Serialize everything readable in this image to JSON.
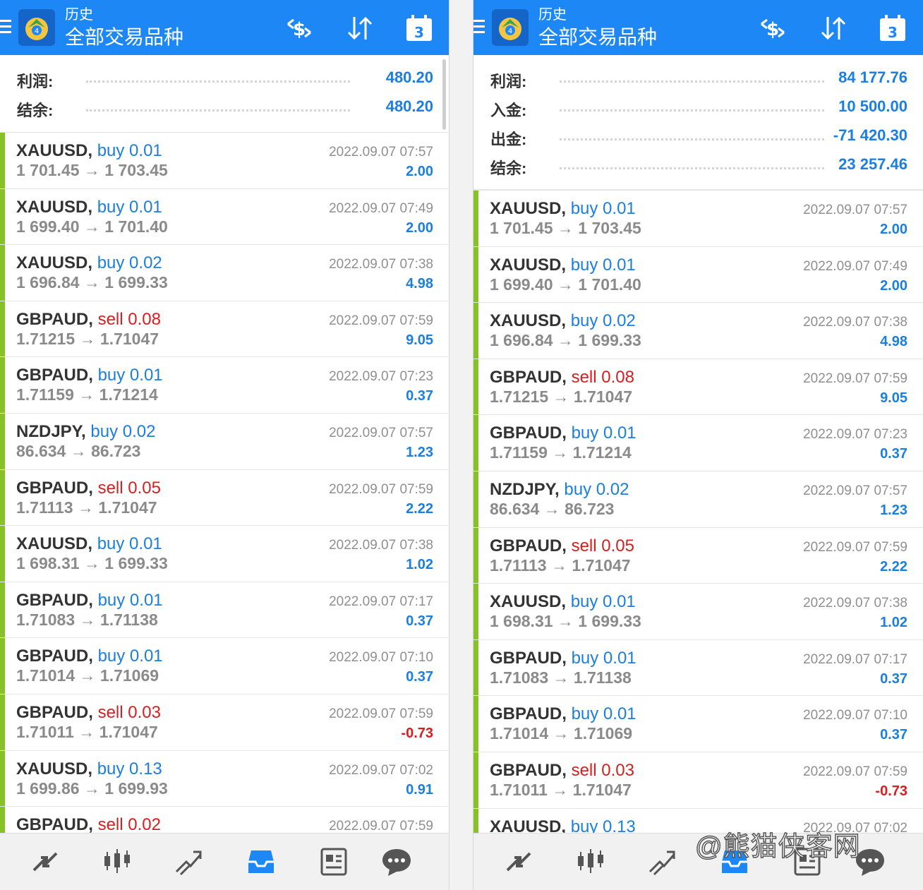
{
  "colors": {
    "header": "#1d88f5",
    "accent": "#1a7fe0",
    "sell": "#d81e1e",
    "profit_bar": "#86c225"
  },
  "left": {
    "header": {
      "subtitle": "历史",
      "title": "全部交易品种",
      "calendar_day": "3"
    },
    "summary": [
      {
        "label": "利润:",
        "value": "480.20"
      },
      {
        "label": "结余:",
        "value": "480.20"
      }
    ],
    "deals": [
      {
        "symbol": "XAUUSD,",
        "type": "buy 0.01",
        "side": "buy",
        "prices": "1 701.45 → 1 703.45",
        "time": "2022.09.07 07:57",
        "profit": "2.00"
      },
      {
        "symbol": "XAUUSD,",
        "type": "buy 0.01",
        "side": "buy",
        "prices": "1 699.40 → 1 701.40",
        "time": "2022.09.07 07:49",
        "profit": "2.00"
      },
      {
        "symbol": "XAUUSD,",
        "type": "buy 0.02",
        "side": "buy",
        "prices": "1 696.84 → 1 699.33",
        "time": "2022.09.07 07:38",
        "profit": "4.98"
      },
      {
        "symbol": "GBPAUD,",
        "type": "sell 0.08",
        "side": "sell",
        "prices": "1.71215 → 1.71047",
        "time": "2022.09.07 07:59",
        "profit": "9.05"
      },
      {
        "symbol": "GBPAUD,",
        "type": "buy 0.01",
        "side": "buy",
        "prices": "1.71159 → 1.71214",
        "time": "2022.09.07 07:23",
        "profit": "0.37"
      },
      {
        "symbol": "NZDJPY,",
        "type": "buy 0.02",
        "side": "buy",
        "prices": "86.634 → 86.723",
        "time": "2022.09.07 07:57",
        "profit": "1.23"
      },
      {
        "symbol": "GBPAUD,",
        "type": "sell 0.05",
        "side": "sell",
        "prices": "1.71113 → 1.71047",
        "time": "2022.09.07 07:59",
        "profit": "2.22"
      },
      {
        "symbol": "XAUUSD,",
        "type": "buy 0.01",
        "side": "buy",
        "prices": "1 698.31 → 1 699.33",
        "time": "2022.09.07 07:38",
        "profit": "1.02"
      },
      {
        "symbol": "GBPAUD,",
        "type": "buy 0.01",
        "side": "buy",
        "prices": "1.71083 → 1.71138",
        "time": "2022.09.07 07:17",
        "profit": "0.37"
      },
      {
        "symbol": "GBPAUD,",
        "type": "buy 0.01",
        "side": "buy",
        "prices": "1.71014 → 1.71069",
        "time": "2022.09.07 07:10",
        "profit": "0.37"
      },
      {
        "symbol": "GBPAUD,",
        "type": "sell 0.03",
        "side": "sell",
        "prices": "1.71011 → 1.71047",
        "time": "2022.09.07 07:59",
        "profit": "-0.73"
      },
      {
        "symbol": "XAUUSD,",
        "type": "buy 0.13",
        "side": "buy",
        "prices": "1 699.86 → 1 699.93",
        "time": "2022.09.07 07:02",
        "profit": "0.91"
      },
      {
        "symbol": "GBPAUD,",
        "type": "sell 0.02",
        "side": "sell",
        "prices": "",
        "time": "2022.09.07 07:59",
        "profit": ""
      }
    ]
  },
  "right": {
    "header": {
      "subtitle": "历史",
      "title": "全部交易品种",
      "calendar_day": "3"
    },
    "summary": [
      {
        "label": "利润:",
        "value": "84 177.76"
      },
      {
        "label": "入金:",
        "value": "10 500.00"
      },
      {
        "label": "出金:",
        "value": "-71 420.30"
      },
      {
        "label": "结余:",
        "value": "23 257.46"
      }
    ],
    "deals": [
      {
        "symbol": "XAUUSD,",
        "type": "buy 0.01",
        "side": "buy",
        "prices": "1 701.45 → 1 703.45",
        "time": "2022.09.07 07:57",
        "profit": "2.00"
      },
      {
        "symbol": "XAUUSD,",
        "type": "buy 0.01",
        "side": "buy",
        "prices": "1 699.40 → 1 701.40",
        "time": "2022.09.07 07:49",
        "profit": "2.00"
      },
      {
        "symbol": "XAUUSD,",
        "type": "buy 0.02",
        "side": "buy",
        "prices": "1 696.84 → 1 699.33",
        "time": "2022.09.07 07:38",
        "profit": "4.98"
      },
      {
        "symbol": "GBPAUD,",
        "type": "sell 0.08",
        "side": "sell",
        "prices": "1.71215 → 1.71047",
        "time": "2022.09.07 07:59",
        "profit": "9.05"
      },
      {
        "symbol": "GBPAUD,",
        "type": "buy 0.01",
        "side": "buy",
        "prices": "1.71159 → 1.71214",
        "time": "2022.09.07 07:23",
        "profit": "0.37"
      },
      {
        "symbol": "NZDJPY,",
        "type": "buy 0.02",
        "side": "buy",
        "prices": "86.634 → 86.723",
        "time": "2022.09.07 07:57",
        "profit": "1.23"
      },
      {
        "symbol": "GBPAUD,",
        "type": "sell 0.05",
        "side": "sell",
        "prices": "1.71113 → 1.71047",
        "time": "2022.09.07 07:59",
        "profit": "2.22"
      },
      {
        "symbol": "XAUUSD,",
        "type": "buy 0.01",
        "side": "buy",
        "prices": "1 698.31 → 1 699.33",
        "time": "2022.09.07 07:38",
        "profit": "1.02"
      },
      {
        "symbol": "GBPAUD,",
        "type": "buy 0.01",
        "side": "buy",
        "prices": "1.71083 → 1.71138",
        "time": "2022.09.07 07:17",
        "profit": "0.37"
      },
      {
        "symbol": "GBPAUD,",
        "type": "buy 0.01",
        "side": "buy",
        "prices": "1.71014 → 1.71069",
        "time": "2022.09.07 07:10",
        "profit": "0.37"
      },
      {
        "symbol": "GBPAUD,",
        "type": "sell 0.03",
        "side": "sell",
        "prices": "1.71011 → 1.71047",
        "time": "2022.09.07 07:59",
        "profit": "-0.73"
      },
      {
        "symbol": "XAUUSD,",
        "type": "buy 0.13",
        "side": "buy",
        "prices": "",
        "time": "2022.09.07 07:02",
        "profit": ""
      }
    ]
  },
  "bottom_nav": [
    "quotes-icon",
    "chart-icon",
    "trade-icon",
    "history-icon",
    "news-icon",
    "chat-icon"
  ],
  "watermark": "@熊猫侠客网"
}
